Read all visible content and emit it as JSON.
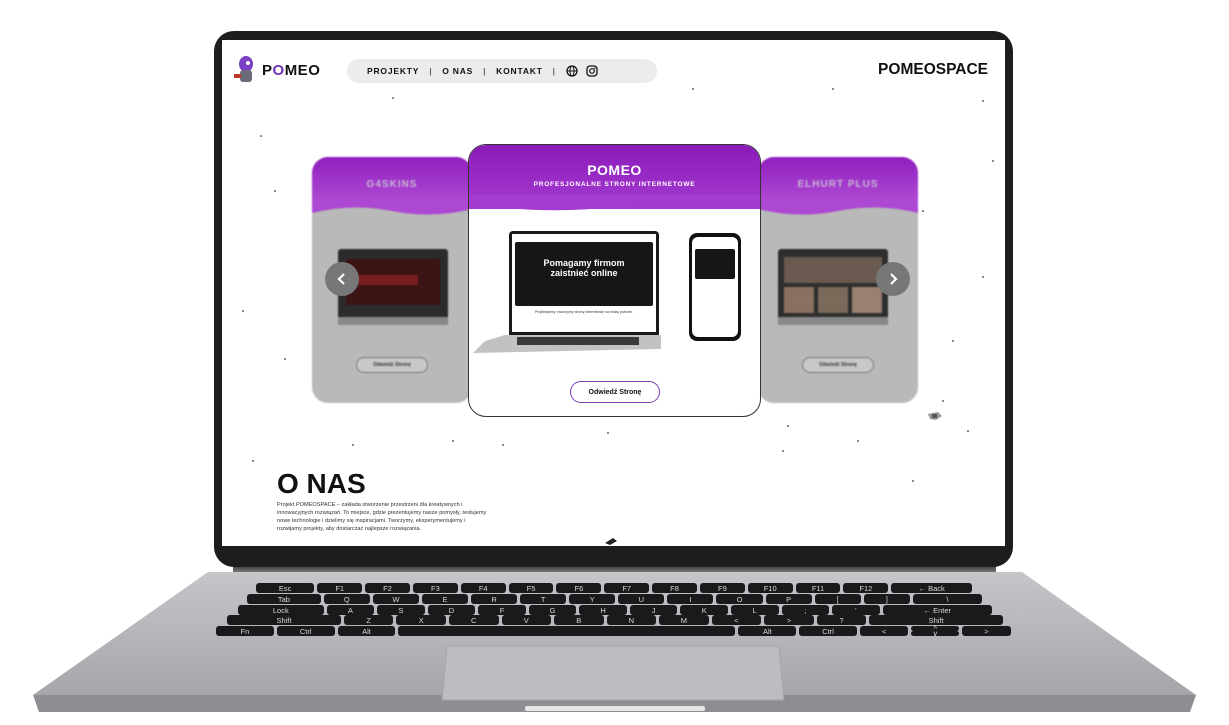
{
  "header": {
    "logo_text_a": "P",
    "logo_text_o": "O",
    "logo_text_b": "MEO",
    "nav": [
      "PROJEKTY",
      "O NAS",
      "KONTAKT"
    ],
    "brand": "POMEOSPACE"
  },
  "carousel": {
    "left_title": "G4SKINS",
    "left_button": "Odwiedź Stronę",
    "center_title": "POMEO",
    "center_subtitle": "PROFESJONALNE STRONY INTERNETOWE",
    "center_button": "Odwiedź Stronę",
    "right_title": "ELHURT PLUS",
    "right_button": "Odwiedź Stronę",
    "preview_headline": "Pomagamy firmom zaistnieć online",
    "preview_caption": "Projektujemy i tworzymy strony internetowe na miarę potrzeb."
  },
  "about": {
    "heading": "O NAS",
    "text": "Projekt POMEOSPACE – zakłada stworzenie przestrzeni dla kreatywnych i innowacyjnych rozwiązań. To miejsce, gdzie prezentujemy nasze pomysły, testujemy nowe technologie i dzielimy się inspiracjami. Tworzymy, eksperymentujemy i rozwijamy projekty, aby dostarczać najlepsze rozwiązania."
  },
  "keyboard": {
    "row1": [
      "Esc",
      "F1",
      "F2",
      "F3",
      "F4",
      "F5",
      "F6",
      "F7",
      "F8",
      "F9",
      "F10",
      "F11",
      "F12",
      "← Back"
    ],
    "row2": [
      "Tab",
      "Q",
      "W",
      "E",
      "R",
      "T",
      "Y",
      "U",
      "I",
      "O",
      "P",
      "[",
      "]",
      "\\"
    ],
    "row3": [
      "Lock",
      "A",
      "S",
      "D",
      "F",
      "G",
      "H",
      "J",
      "K",
      "L",
      ";",
      "'",
      "← Enter"
    ],
    "row4": [
      "Shift",
      "Z",
      "X",
      "C",
      "V",
      "B",
      "N",
      "M",
      "<",
      ">",
      "?",
      "Shift"
    ],
    "row5": [
      "Fn",
      "Ctrl",
      "Alt",
      "",
      "Alt",
      "Ctrl",
      "<",
      "^",
      "∨",
      ">"
    ]
  },
  "colors": {
    "accent": "#8b1ab8",
    "bezel": "#1d1d1f",
    "body": "#b4b4b8"
  }
}
